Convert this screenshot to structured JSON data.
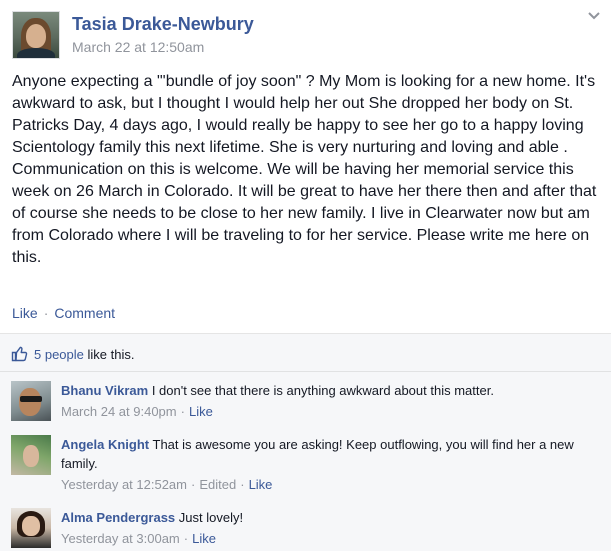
{
  "post": {
    "author": "Tasia Drake-Newbury",
    "timestamp": "March 22 at 12:50am",
    "text": "Anyone expecting a \"'bundle of joy soon\" ? My Mom is looking for a new home. It's awkward to ask, but I thought I would help her out She dropped her body on St. Patricks Day, 4 days ago, I would really be happy to see her go to a happy loving Scientology family this next lifetime. She is very nurturing and loving and able . Communication on this is welcome. We will be having her memorial service this week on 26 March in Colorado. It will be great to have her there then and after that of course she needs to be close to her new family. I live in Clearwater now but am from Colorado where I will be traveling to for her service. Please write me here on this.",
    "actions": {
      "like": "Like",
      "separator": "·",
      "comment": "Comment"
    }
  },
  "likes": {
    "count_text": "5 people",
    "suffix": " like this."
  },
  "comments": [
    {
      "author": "Bhanu Vikram",
      "text": "I don't see that there is anything awkward about this matter.",
      "time": "March 24 at 9:40pm",
      "separator": "·",
      "like": "Like"
    },
    {
      "author": "Angela Knight",
      "text": "That is awesome you are asking! Keep outflowing, you will find her a new family.",
      "time": "Yesterday at 12:52am",
      "separator": "·",
      "edited": "Edited",
      "separator2": "·",
      "like": "Like"
    },
    {
      "author": "Alma Pendergrass",
      "text": "Just lovely!",
      "time": "Yesterday at 3:00am",
      "separator": "·",
      "like": "Like"
    }
  ],
  "icons": {
    "options": "chevron-down-icon",
    "like": "thumbs-up-icon"
  },
  "colors": {
    "link": "#3b5998",
    "meta": "#90949c",
    "ufi_bg": "#f6f7f9"
  }
}
